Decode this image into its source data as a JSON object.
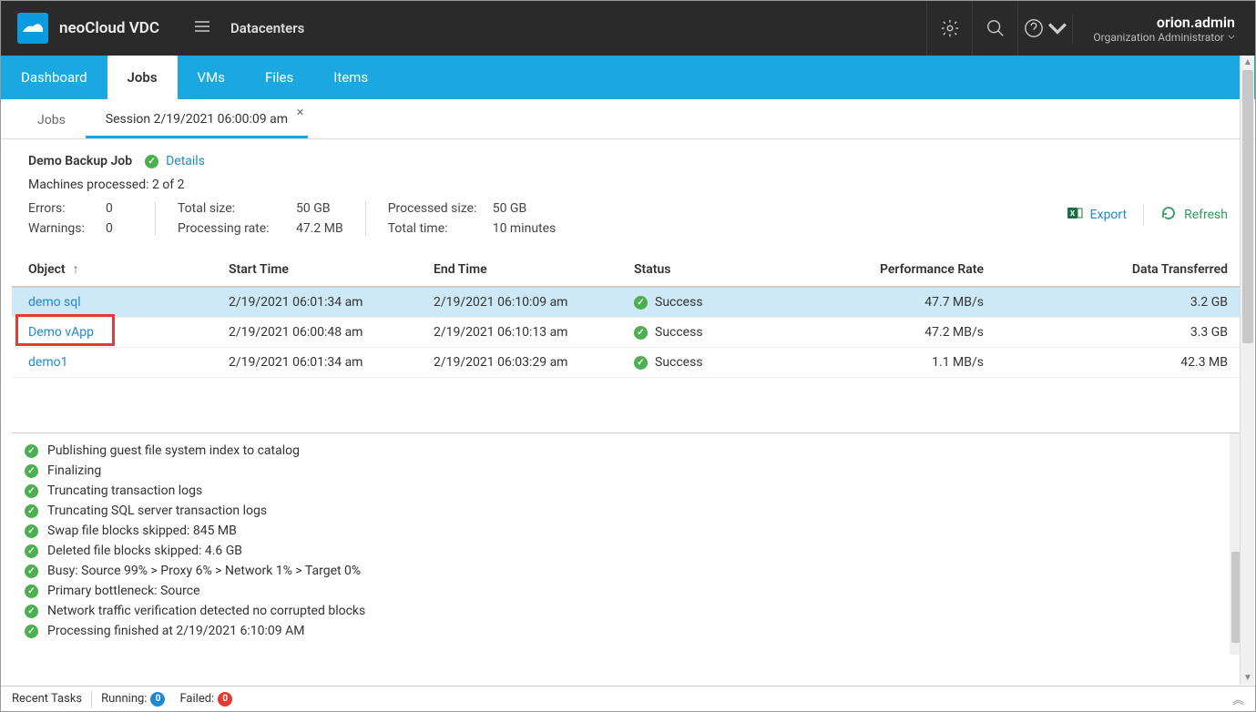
{
  "header": {
    "product": "neoCloud VDC",
    "datacenters": "Datacenters",
    "user_name": "orion.admin",
    "user_role": "Organization Administrator"
  },
  "nav": {
    "dashboard": "Dashboard",
    "jobs": "Jobs",
    "vms": "VMs",
    "files": "Files",
    "items": "Items"
  },
  "sub_tabs": {
    "jobs": "Jobs",
    "session": "Session 2/19/2021 06:00:09 am"
  },
  "job": {
    "name": "Demo Backup Job",
    "details_label": "Details",
    "machines_processed": "Machines processed: 2 of 2",
    "stats": {
      "errors_label": "Errors:",
      "errors_value": "0",
      "warnings_label": "Warnings:",
      "warnings_value": "0",
      "total_size_label": "Total size:",
      "total_size_value": "50 GB",
      "processing_rate_label": "Processing rate:",
      "processing_rate_value": "47.2 MB",
      "processed_size_label": "Processed size:",
      "processed_size_value": "50 GB",
      "total_time_label": "Total time:",
      "total_time_value": "10 minutes"
    },
    "export_label": "Export",
    "refresh_label": "Refresh"
  },
  "table": {
    "cols": {
      "object": "Object",
      "start_time": "Start Time",
      "end_time": "End Time",
      "status": "Status",
      "perf_rate": "Performance Rate",
      "data_trans": "Data Transferred"
    },
    "rows": [
      {
        "object": "demo sql",
        "start": "2/19/2021 06:01:34 am",
        "end": "2/19/2021 06:10:09 am",
        "status": "Success",
        "rate": "47.7 MB/s",
        "data": "3.2 GB"
      },
      {
        "object": "Demo vApp",
        "start": "2/19/2021 06:00:48 am",
        "end": "2/19/2021 06:10:13 am",
        "status": "Success",
        "rate": "47.2 MB/s",
        "data": "3.3 GB"
      },
      {
        "object": "demo1",
        "start": "2/19/2021 06:01:34 am",
        "end": "2/19/2021 06:03:29 am",
        "status": "Success",
        "rate": "1.1 MB/s",
        "data": "42.3 MB"
      }
    ]
  },
  "log_lines": [
    "Publishing guest file system index to catalog",
    "Finalizing",
    "Truncating transaction logs",
    "Truncating SQL server transaction logs",
    "Swap file blocks skipped: 845 MB",
    "Deleted file blocks skipped: 4.6 GB",
    "Busy: Source 99% > Proxy 6% > Network 1% > Target 0%",
    "Primary bottleneck: Source",
    "Network traffic verification detected no corrupted blocks",
    "Processing finished at 2/19/2021 6:10:09 AM"
  ],
  "footer": {
    "recent_tasks": "Recent Tasks",
    "running_label": "Running:",
    "running_value": "0",
    "failed_label": "Failed:",
    "failed_value": "0"
  }
}
